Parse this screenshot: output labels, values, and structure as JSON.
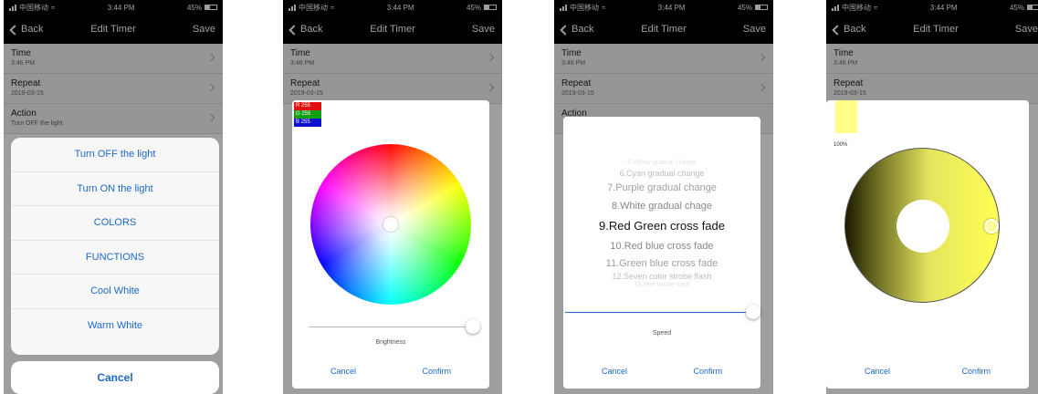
{
  "status_bar": {
    "carrier": "中国移动",
    "time": "3:44 PM",
    "battery": "45%",
    "battery_level": 0.45
  },
  "nav": {
    "back_label": "Back",
    "title": "Edit Timer",
    "save_label": "Save"
  },
  "settings": [
    {
      "title": "Time",
      "value": "3:46 PM"
    },
    {
      "title": "Repeat",
      "value": "2019-03-15"
    },
    {
      "title": "Action",
      "value": "Turn OFF the light"
    }
  ],
  "action_sheet": {
    "options": [
      "Turn OFF the light",
      "Turn ON the light",
      "COLORS",
      "FUNCTIONS",
      "Cool White",
      "Warm White"
    ],
    "cancel_label": "Cancel"
  },
  "color_dialog": {
    "rgb": {
      "r": "R 255",
      "g": "G 255",
      "b": "B 255"
    },
    "brightness_label": "Brightness",
    "brightness_level": 1.0,
    "cancel_label": "Cancel",
    "confirm_label": "Confirm"
  },
  "function_dialog": {
    "modes": [
      "5.Yellow gradual change",
      "6.Cyan gradual change",
      "7.Purple gradual change",
      "8.White gradual chage",
      "9.Red Green cross fade",
      "10.Red blue cross fade",
      "11.Green blue cross fade",
      "12.Seven color strobe flash",
      "13.Red strobe flash"
    ],
    "selected_index": 4,
    "speed_label": "Speed",
    "speed_level": 1.0,
    "cancel_label": "Cancel",
    "confirm_label": "Confirm"
  },
  "white_dialog": {
    "percent_label": "100%",
    "cancel_label": "Cancel",
    "confirm_label": "Confirm"
  },
  "colors": {
    "ios_blue": "#1b6ac9",
    "bar_black": "#000000",
    "slider_blue": "#1b6ac9",
    "swatch_yellow": "#ffff88"
  }
}
